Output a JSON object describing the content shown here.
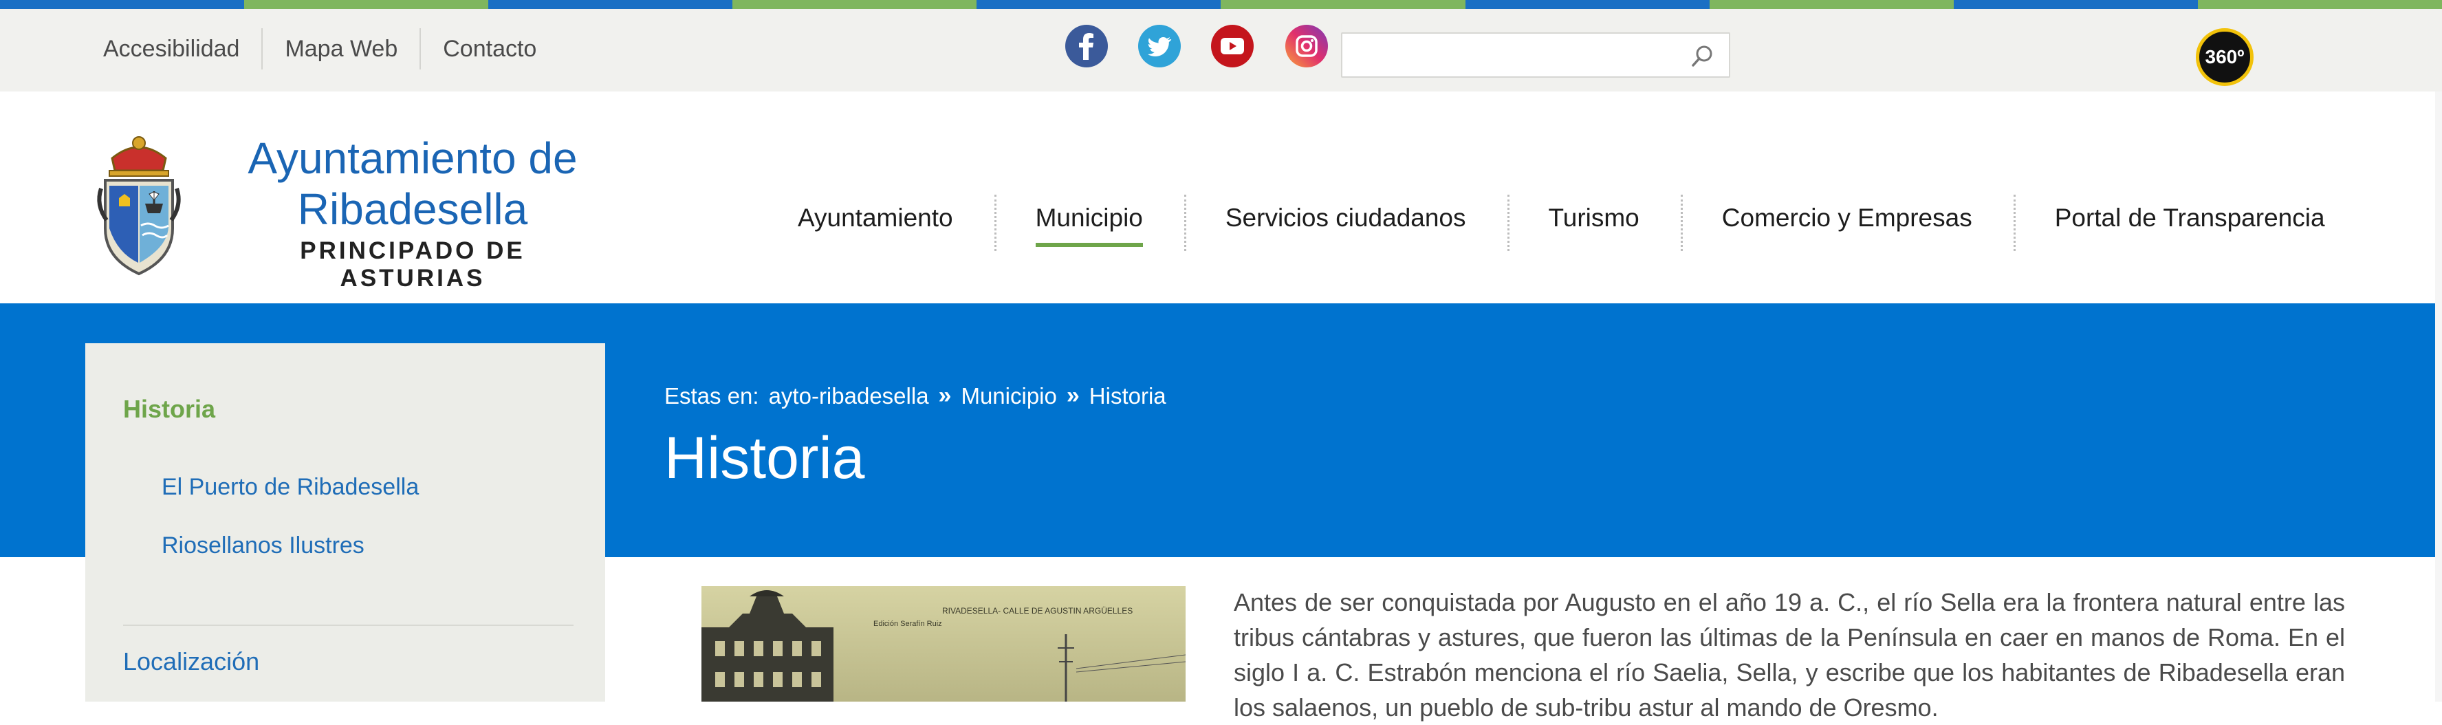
{
  "top_links": [
    "Accesibilidad",
    "Mapa Web",
    "Contacto"
  ],
  "social_icons": [
    "facebook-icon",
    "twitter-icon",
    "youtube-icon",
    "instagram-icon"
  ],
  "search": {
    "value": "",
    "placeholder": ""
  },
  "badge_360": "360º",
  "brand": {
    "title": "Ayuntamiento de Ribadesella",
    "subtitle": "PRINCIPADO DE ASTURIAS"
  },
  "nav": [
    {
      "label": "Ayuntamiento",
      "active": false
    },
    {
      "label": "Municipio",
      "active": true
    },
    {
      "label": "Servicios ciudadanos",
      "active": false
    },
    {
      "label": "Turismo",
      "active": false
    },
    {
      "label": "Comercio y Empresas",
      "active": false
    },
    {
      "label": "Portal de Transparencia",
      "active": false
    }
  ],
  "breadcrumb": {
    "prefix": "Estas en:",
    "items": [
      "ayto-ribadesella",
      "Municipio",
      "Historia"
    ],
    "separator": "»"
  },
  "page_title": "Historia",
  "sidebar": {
    "heading": "Historia",
    "subitems": [
      "El Puerto de Ribadesella",
      "Riosellanos Ilustres"
    ],
    "next_item": "Localización"
  },
  "photo_caption": "RIVADESELLA- CALLE DE AGUSTIN ARGÜELLES",
  "photo_credit": "Edición Serafín Ruiz",
  "body_text": "Antes de ser conquistada por Augusto en el año 19 a. C., el río Sella era la frontera natural entre las tribus cántabras y astures, que fueron las últimas de la Península en caer en manos de Roma. En el siglo I a. C. Estrabón menciona el río Saelia, Sella, y escribe que los habitantes de Ribadesella eran los salaenos, un pueblo de sub-tribu astur al mando de Oresmo.",
  "colors": {
    "accent_blue": "#0073cf",
    "link_blue": "#1f6db7",
    "green": "#6ea54a",
    "stripe_blue": "#1a6fc4",
    "stripe_green": "#7fb65e"
  }
}
